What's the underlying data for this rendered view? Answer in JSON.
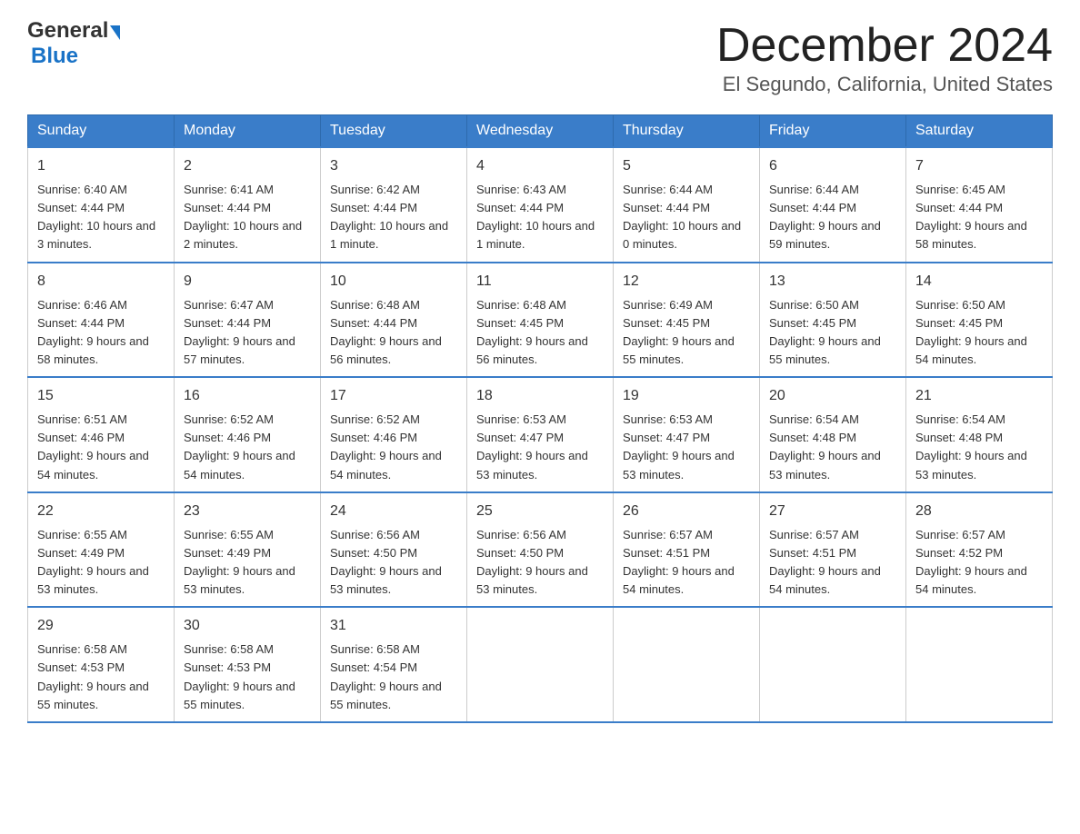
{
  "logo": {
    "general": "General",
    "blue": "Blue",
    "arrow": "▶"
  },
  "title": "December 2024",
  "subtitle": "El Segundo, California, United States",
  "days": [
    "Sunday",
    "Monday",
    "Tuesday",
    "Wednesday",
    "Thursday",
    "Friday",
    "Saturday"
  ],
  "weeks": [
    [
      {
        "num": "1",
        "sunrise": "6:40 AM",
        "sunset": "4:44 PM",
        "daylight": "10 hours and 3 minutes."
      },
      {
        "num": "2",
        "sunrise": "6:41 AM",
        "sunset": "4:44 PM",
        "daylight": "10 hours and 2 minutes."
      },
      {
        "num": "3",
        "sunrise": "6:42 AM",
        "sunset": "4:44 PM",
        "daylight": "10 hours and 1 minute."
      },
      {
        "num": "4",
        "sunrise": "6:43 AM",
        "sunset": "4:44 PM",
        "daylight": "10 hours and 1 minute."
      },
      {
        "num": "5",
        "sunrise": "6:44 AM",
        "sunset": "4:44 PM",
        "daylight": "10 hours and 0 minutes."
      },
      {
        "num": "6",
        "sunrise": "6:44 AM",
        "sunset": "4:44 PM",
        "daylight": "9 hours and 59 minutes."
      },
      {
        "num": "7",
        "sunrise": "6:45 AM",
        "sunset": "4:44 PM",
        "daylight": "9 hours and 58 minutes."
      }
    ],
    [
      {
        "num": "8",
        "sunrise": "6:46 AM",
        "sunset": "4:44 PM",
        "daylight": "9 hours and 58 minutes."
      },
      {
        "num": "9",
        "sunrise": "6:47 AM",
        "sunset": "4:44 PM",
        "daylight": "9 hours and 57 minutes."
      },
      {
        "num": "10",
        "sunrise": "6:48 AM",
        "sunset": "4:44 PM",
        "daylight": "9 hours and 56 minutes."
      },
      {
        "num": "11",
        "sunrise": "6:48 AM",
        "sunset": "4:45 PM",
        "daylight": "9 hours and 56 minutes."
      },
      {
        "num": "12",
        "sunrise": "6:49 AM",
        "sunset": "4:45 PM",
        "daylight": "9 hours and 55 minutes."
      },
      {
        "num": "13",
        "sunrise": "6:50 AM",
        "sunset": "4:45 PM",
        "daylight": "9 hours and 55 minutes."
      },
      {
        "num": "14",
        "sunrise": "6:50 AM",
        "sunset": "4:45 PM",
        "daylight": "9 hours and 54 minutes."
      }
    ],
    [
      {
        "num": "15",
        "sunrise": "6:51 AM",
        "sunset": "4:46 PM",
        "daylight": "9 hours and 54 minutes."
      },
      {
        "num": "16",
        "sunrise": "6:52 AM",
        "sunset": "4:46 PM",
        "daylight": "9 hours and 54 minutes."
      },
      {
        "num": "17",
        "sunrise": "6:52 AM",
        "sunset": "4:46 PM",
        "daylight": "9 hours and 54 minutes."
      },
      {
        "num": "18",
        "sunrise": "6:53 AM",
        "sunset": "4:47 PM",
        "daylight": "9 hours and 53 minutes."
      },
      {
        "num": "19",
        "sunrise": "6:53 AM",
        "sunset": "4:47 PM",
        "daylight": "9 hours and 53 minutes."
      },
      {
        "num": "20",
        "sunrise": "6:54 AM",
        "sunset": "4:48 PM",
        "daylight": "9 hours and 53 minutes."
      },
      {
        "num": "21",
        "sunrise": "6:54 AM",
        "sunset": "4:48 PM",
        "daylight": "9 hours and 53 minutes."
      }
    ],
    [
      {
        "num": "22",
        "sunrise": "6:55 AM",
        "sunset": "4:49 PM",
        "daylight": "9 hours and 53 minutes."
      },
      {
        "num": "23",
        "sunrise": "6:55 AM",
        "sunset": "4:49 PM",
        "daylight": "9 hours and 53 minutes."
      },
      {
        "num": "24",
        "sunrise": "6:56 AM",
        "sunset": "4:50 PM",
        "daylight": "9 hours and 53 minutes."
      },
      {
        "num": "25",
        "sunrise": "6:56 AM",
        "sunset": "4:50 PM",
        "daylight": "9 hours and 53 minutes."
      },
      {
        "num": "26",
        "sunrise": "6:57 AM",
        "sunset": "4:51 PM",
        "daylight": "9 hours and 54 minutes."
      },
      {
        "num": "27",
        "sunrise": "6:57 AM",
        "sunset": "4:51 PM",
        "daylight": "9 hours and 54 minutes."
      },
      {
        "num": "28",
        "sunrise": "6:57 AM",
        "sunset": "4:52 PM",
        "daylight": "9 hours and 54 minutes."
      }
    ],
    [
      {
        "num": "29",
        "sunrise": "6:58 AM",
        "sunset": "4:53 PM",
        "daylight": "9 hours and 55 minutes."
      },
      {
        "num": "30",
        "sunrise": "6:58 AM",
        "sunset": "4:53 PM",
        "daylight": "9 hours and 55 minutes."
      },
      {
        "num": "31",
        "sunrise": "6:58 AM",
        "sunset": "4:54 PM",
        "daylight": "9 hours and 55 minutes."
      },
      null,
      null,
      null,
      null
    ]
  ]
}
